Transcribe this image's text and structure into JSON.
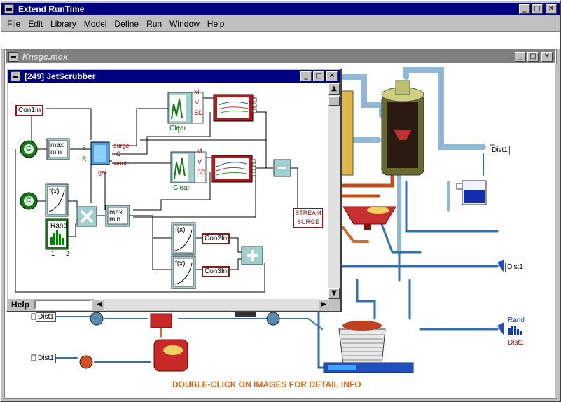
{
  "app": {
    "title": "Extend RunTime",
    "menu": [
      "File",
      "Edit",
      "Library",
      "Model",
      "Define",
      "Run",
      "Window",
      "Help"
    ]
  },
  "model_window": {
    "title": "Knsgc.mox",
    "footer_note": "DOUBLE-CLICK ON IMAGES FOR DETAIL INFO",
    "labels": {
      "dist_top_right": "Dist1",
      "dist_right_mid": "Dist1",
      "rand_label": "Rand",
      "dist_rand": "Dist1",
      "dist_left_1": "Dist1",
      "dist_left_2": "Dist1"
    }
  },
  "sub_window": {
    "title": "[249]   JetScrubber",
    "help_label": "Help",
    "blocks": {
      "con1in": "Con1In",
      "con2in": "Con2In",
      "con3in": "Con3In",
      "const_c1": "C",
      "const_c2": "C",
      "maxmin1_top": "max",
      "maxmin1_bottom": "min",
      "maxmin2_top": "max",
      "maxmin2_bottom": "min",
      "fx1": "f(x)",
      "fx2": "f(x)",
      "fx3": "f(x)",
      "rand": "Rand",
      "port_s": "S",
      "port_r": "R",
      "port_surge": "surge",
      "port_c": "C",
      "port_want": "want",
      "port_get": "get",
      "stat1_m": "M",
      "stat1_v": "V",
      "stat1_sd": "SD",
      "stat2_m": "M",
      "stat2_v": "V",
      "stat2_sd": "SD",
      "clear1": "Clear",
      "clear2": "Clear",
      "stream": "STREAM",
      "surge": "SURGE",
      "rand_port1": "1",
      "rand_port2": "2"
    }
  },
  "colors": {
    "title_active": "#000080",
    "title_inactive": "#808080",
    "label_border": "#8b1a1a",
    "green_block": "#127a12",
    "block_teal": "#9ed0d0",
    "plot_red": "#b31b1b",
    "footer_text": "#d07020"
  }
}
